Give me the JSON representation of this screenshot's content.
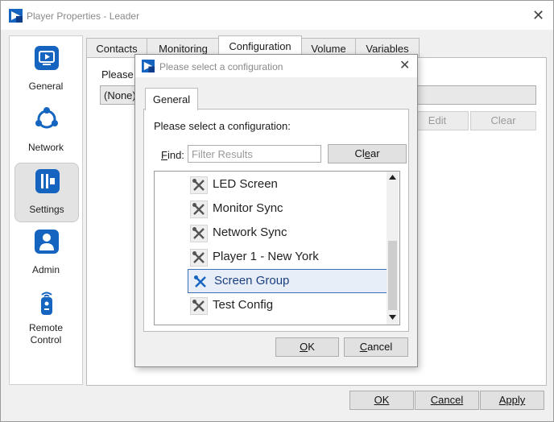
{
  "window": {
    "title": "Player Properties - Leader",
    "close": "✕"
  },
  "sidebar": {
    "items": [
      {
        "label": "General",
        "icon": "monitor-play-icon"
      },
      {
        "label": "Network",
        "icon": "network-icon"
      },
      {
        "label": "Settings",
        "icon": "settings-icon",
        "selected": true
      },
      {
        "label": "Admin",
        "icon": "admin-user-icon"
      },
      {
        "label": "Remote\nControl",
        "icon": "remote-control-icon"
      }
    ]
  },
  "tabs": [
    "Contacts",
    "Monitoring",
    "Configuration",
    "Volume",
    "Variables"
  ],
  "selected_tab": "Configuration",
  "content": {
    "prompt": "Please s",
    "combo_value": "(None)",
    "edit_label": "Edit",
    "clear_label": "Clear"
  },
  "footer": {
    "ok_label": "OK",
    "cancel_label": "Cancel",
    "apply_label": "Apply"
  },
  "dialog": {
    "title": "Please select a configuration",
    "close": "✕",
    "tab": "General",
    "prompt": "Please select a configuration:",
    "find_label_u": "F",
    "find_label_rest": "ind:",
    "find_placeholder": "Filter Results",
    "clear_u": "e",
    "clear_pre": "Cl",
    "clear_post": "ar",
    "items": [
      "LED Screen",
      "Monitor Sync",
      "Network Sync",
      "Player 1 - New York",
      "Screen Group",
      "Test Config"
    ],
    "selected_item": "Screen Group",
    "ok_u": "O",
    "ok_rest": "K",
    "cancel_u": "C",
    "cancel_rest": "ancel"
  },
  "colors": {
    "accent": "#1565c0",
    "selection_border": "#3d6fb5"
  }
}
